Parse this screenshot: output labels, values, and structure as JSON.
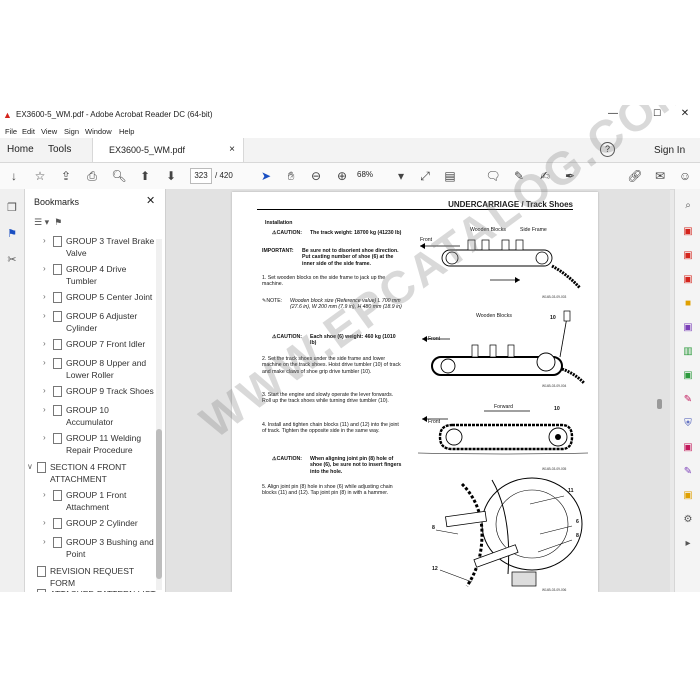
{
  "window": {
    "title": "EX3600-5_WM.pdf - Adobe Acrobat Reader DC (64-bit)",
    "minimize": "—",
    "maximize": "☐",
    "close": "✕"
  },
  "menu": [
    "File",
    "Edit",
    "View",
    "Sign",
    "Window",
    "Help"
  ],
  "tabs": {
    "home": "Home",
    "tools": "Tools",
    "document": "EX3600-5_WM.pdf",
    "doc_close": "×"
  },
  "account": {
    "help": "?",
    "sign_in": "Sign In"
  },
  "toolbar": {
    "page_current": "323",
    "page_total": "/ 420",
    "zoom": "68%"
  },
  "bookmarks": {
    "header": "Bookmarks",
    "items": [
      {
        "label": "GROUP 3 Travel Brake",
        "label2": "Valve",
        "expanded": false
      },
      {
        "label": "GROUP 4 Drive",
        "label2": "Tumbler",
        "expanded": false
      },
      {
        "label": "GROUP 5 Center Joint",
        "label2": "",
        "expanded": false
      },
      {
        "label": "GROUP 6 Adjuster",
        "label2": "Cylinder",
        "expanded": false
      },
      {
        "label": "GROUP 7 Front Idler",
        "label2": "",
        "expanded": false
      },
      {
        "label": "GROUP 8 Upper and",
        "label2": "Lower Roller",
        "expanded": false
      },
      {
        "label": "GROUP 9 Track Shoes",
        "label2": "",
        "expanded": false
      },
      {
        "label": "GROUP 10",
        "label2": "Accumulator",
        "expanded": false
      },
      {
        "label": "GROUP 11 Welding",
        "label2": "Repair Procedure",
        "expanded": false
      },
      {
        "label": "SECTION 4 FRONT",
        "label2": "ATTACHMENT",
        "expanded": true
      },
      {
        "label": "GROUP 1 Front",
        "label2": "Attachment",
        "expanded": false
      },
      {
        "label": "GROUP 2 Cylinder",
        "label2": "",
        "expanded": false
      },
      {
        "label": "GROUP 3 Bushing and",
        "label2": "Point",
        "expanded": false
      },
      {
        "label": "REVISION REQUEST",
        "label2": "FORM",
        "expanded": false
      },
      {
        "label": "ATTACHED PATTERN LIST",
        "label2": "",
        "expanded": false
      }
    ]
  },
  "document": {
    "header": "UNDERCARRIAGE / Track Shoes",
    "installation": "Installation",
    "caution1": {
      "label": "CAUTION:",
      "text": "The track weight: 18700 kg (41230 lb)"
    },
    "important": {
      "label": "IMPORTANT:",
      "text": "Be sure not to disorient shoe direction. Put casting number of shoe (6) at the inner side of the side frame."
    },
    "step1": "1. Set wooden blocks on the side frame to jack up the machine.",
    "note": {
      "label": "NOTE:",
      "text": "Wooden block size (Reference value) L 700 mm (27.6 in), W 200 mm (7.9 in), H 480 mm (18.9 in)"
    },
    "caution2": {
      "label": "CAUTION:",
      "text": "Each shoe (6) weight: 460 kg (1010 lb)"
    },
    "step2": "2. Set the track shoes under the side frame and lower machine on the track shoes. Hoist drive tumbler (10) of track and make claws of shoe grip drive tumbler (10).",
    "step3": "3. Start the engine and slowly operate the lever forwards. Roll up the track shoes while turning drive tumbler (10).",
    "step4": "4. Install and tighten chain blocks (11) and (12) into the joint of track. Tighten the opposite side in the same way.",
    "caution3": {
      "label": "CAUTION:",
      "text": "When aligning joint pin (8) hole of shoe (6), be sure not to insert fingers into the hole."
    },
    "step5": "5. Align joint pin (8) hole in shoe (6) while adjusting chain blocks (11) and (12). Tap joint pin (8) in with a hammer.",
    "fig1": {
      "front": "Front",
      "wooden": "Wooden Blocks",
      "side": "Side Frame",
      "id": "W14B-03-09-003"
    },
    "fig2": {
      "front": "Front",
      "wooden": "Wooden Blocks",
      "num": "10",
      "id": "W14B-03-09-004"
    },
    "fig3": {
      "front": "Front",
      "forward": "Forward",
      "num": "10",
      "id": "W14B-03-09-005"
    },
    "fig4": {
      "n11": "11",
      "n6": "6",
      "n8a": "8",
      "n8b": "8",
      "n12": "12",
      "id": "W14B-03-09-006"
    }
  },
  "watermark": "WWW.EPCATALOG.COM"
}
